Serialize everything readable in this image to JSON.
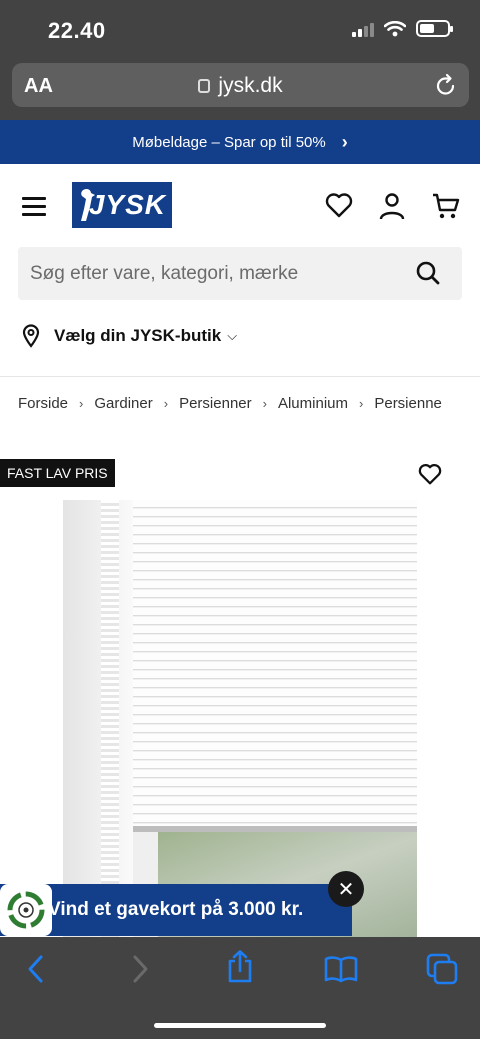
{
  "status_bar": {
    "time": "22.40"
  },
  "browser": {
    "aa": "AA",
    "url": "jysk.dk"
  },
  "promo": {
    "text": "Møbeldage – Spar op til 50%"
  },
  "header": {
    "logo": "JYSK"
  },
  "search": {
    "placeholder": "Søg efter vare, kategori, mærke"
  },
  "store": {
    "label": "Vælg din JYSK-butik"
  },
  "breadcrumb": [
    "Forside",
    "Gardiner",
    "Persienner",
    "Aluminium",
    "Persienne"
  ],
  "product": {
    "badge": "FAST LAV PRIS"
  },
  "gift_popup": {
    "text": "Vind et gavekort på 3.000 kr.",
    "close": "✕"
  },
  "colors": {
    "brand_blue": "#133e8a",
    "chrome_gray": "#434343",
    "ios_blue": "#1e7df0"
  }
}
